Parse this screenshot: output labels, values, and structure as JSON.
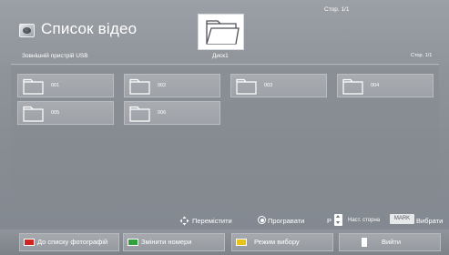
{
  "header": {
    "title": "Список відео",
    "page_top": "Стор. 1/1",
    "device": "Зовнішній пристрій USB",
    "disk": "Диск1",
    "page_right": "Стор. 1/1"
  },
  "folders": [
    {
      "label": "001"
    },
    {
      "label": "002"
    },
    {
      "label": "003"
    },
    {
      "label": "004"
    },
    {
      "label": "005"
    },
    {
      "label": "006"
    }
  ],
  "hints": {
    "move": "Перемістити",
    "play": "Програвати",
    "p_label": "P",
    "next_page": "Наст. сторна",
    "mark_badge": "MARK",
    "select": "Вибрати"
  },
  "buttons": {
    "red": "До списку фотографій",
    "green": "Змінити номери",
    "yellow": "Режим вибору",
    "exit": "Вийти"
  },
  "colors": {
    "red": "#d22222",
    "green": "#2fa33a",
    "yellow": "#e6c21b",
    "blue": "#2a52c9"
  }
}
